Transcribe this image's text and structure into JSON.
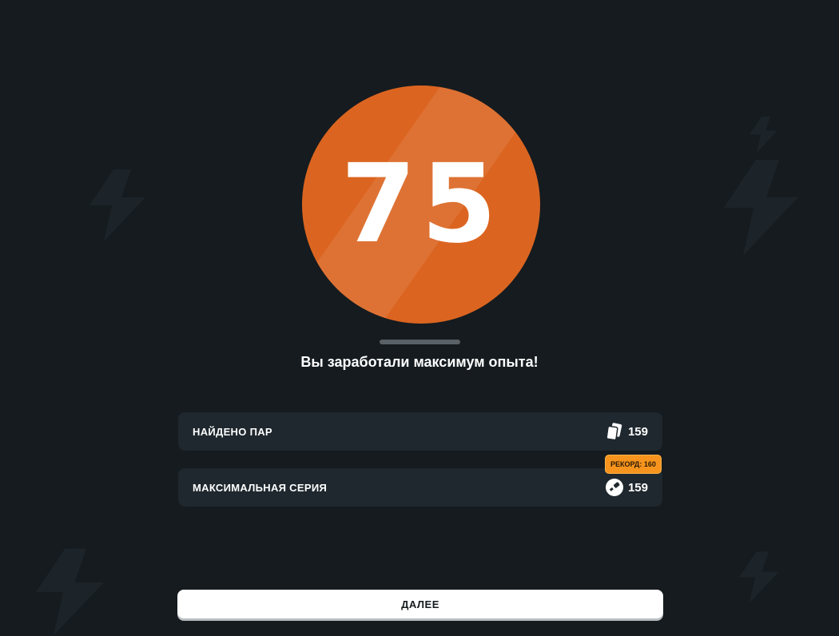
{
  "result": {
    "score": "75",
    "message": "Вы заработали максимум опыта!"
  },
  "stats": [
    {
      "label": "НАЙДЕНО ПАР",
      "value": "159",
      "icon": "cards-icon"
    },
    {
      "label": "МАКСИМАЛЬНАЯ СЕРИЯ",
      "value": "159",
      "icon": "streak-icon",
      "badge": "РЕКОРД: 160"
    }
  ],
  "next_button": "ДАЛЕЕ",
  "colors": {
    "background": "#151b1f",
    "card": "#1f282e",
    "accent": "#db6520",
    "badge": "#f7941d"
  }
}
